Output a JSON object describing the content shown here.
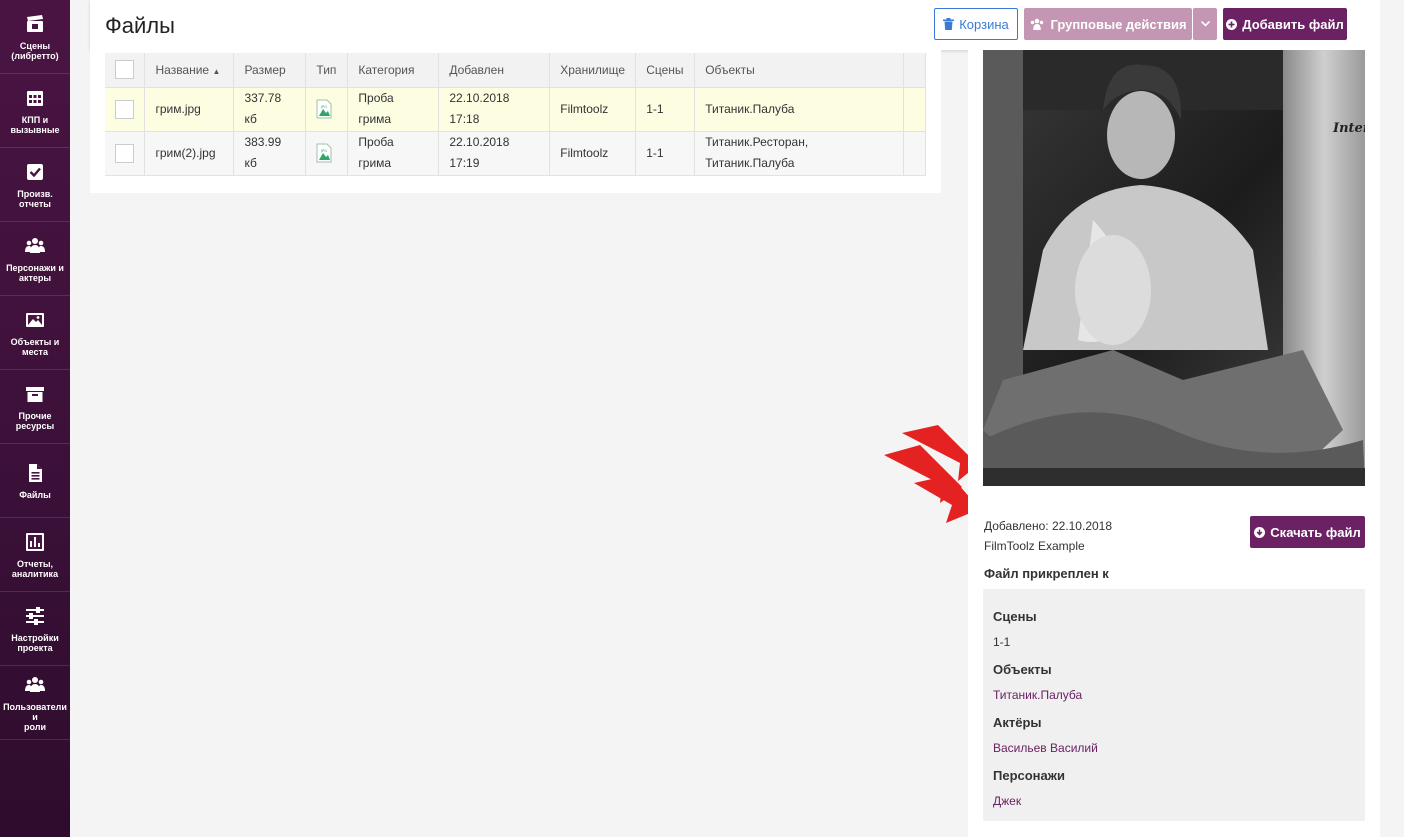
{
  "sidebar": {
    "items": [
      {
        "label": "Сцены\n(либретто)",
        "icon": "clapperboard-icon"
      },
      {
        "label": "КПП и\nвызывные",
        "icon": "calendar-icon"
      },
      {
        "label": "Произв.\nотчеты",
        "icon": "checkbox-icon"
      },
      {
        "label": "Персонажи и\nактеры",
        "icon": "people-icon"
      },
      {
        "label": "Объекты и\nместа",
        "icon": "image-icon"
      },
      {
        "label": "Прочие\nресурсы",
        "icon": "archive-icon"
      },
      {
        "label": "Файлы",
        "icon": "file-icon"
      },
      {
        "label": "Отчеты,\nаналитика",
        "icon": "chart-icon"
      },
      {
        "label": "Настройки\nпроекта",
        "icon": "sliders-icon"
      },
      {
        "label": "Пользователи и\nроли",
        "icon": "users-icon"
      }
    ]
  },
  "header": {
    "title": "Файлы",
    "trash_label": "Корзина",
    "group_label": "Групповые действия",
    "add_label": "Добавить файл"
  },
  "table": {
    "columns": [
      "Название",
      "Размер",
      "Тип",
      "Категория",
      "Добавлен",
      "Хранилище",
      "Сцены",
      "Объекты"
    ],
    "rows": [
      {
        "name": "грим.jpg",
        "size_1": "337.78",
        "size_2": "кб",
        "cat_1": "Проба",
        "cat_2": "грима",
        "date_1": "22.10.2018",
        "date_2": "17:18",
        "storage": "Filmtoolz",
        "scenes": "1-1",
        "objects_1": "Титаник.Палуба",
        "objects_2": ""
      },
      {
        "name": "грим(2).jpg",
        "size_1": "383.99",
        "size_2": "кб",
        "cat_1": "Проба",
        "cat_2": "грима",
        "date_1": "22.10.2018",
        "date_2": "17:19",
        "storage": "Filmtoolz",
        "scenes": "1-1",
        "objects_1": "Титаник.Ресторан,",
        "objects_2": "Титаник.Палуба"
      }
    ]
  },
  "details": {
    "photo_text": "Inter",
    "added": "Добавлено: 22.10.2018",
    "source": "FilmToolz Example",
    "download_label": "Скачать файл",
    "attached_title": "Файл прикреплен к",
    "scenes_h": "Сцены",
    "scenes_v": "1-1",
    "objects_h": "Объекты",
    "objects_v": "Титаник.Палуба",
    "actors_h": "Актёры",
    "actors_v": "Васильев Василий",
    "chars_h": "Персонажи",
    "chars_v": "Джек"
  },
  "colors": {
    "brand": "#6b2163",
    "brand_light": "#c496b3",
    "highlight": "#fdfde2",
    "arrow": "#e52222",
    "link": "#3a7bd5"
  }
}
